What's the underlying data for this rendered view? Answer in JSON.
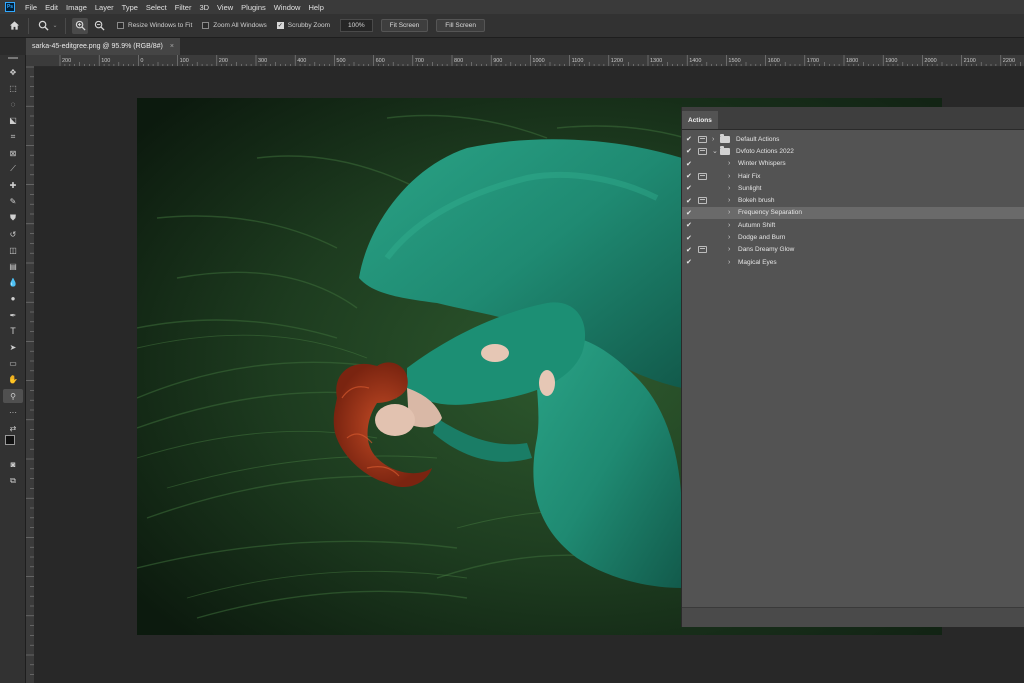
{
  "menubar": {
    "logo": "Ps",
    "items": [
      "File",
      "Edit",
      "Image",
      "Layer",
      "Type",
      "Select",
      "Filter",
      "3D",
      "View",
      "Plugins",
      "Window",
      "Help"
    ]
  },
  "options": {
    "icons": [
      "home-icon",
      "zoom-tool-icon",
      "zoom-in-icon",
      "zoom-out-icon"
    ],
    "resize_windows": {
      "label": "Resize Windows to Fit",
      "checked": false
    },
    "zoom_all": {
      "label": "Zoom All Windows",
      "checked": false
    },
    "scrubby_zoom": {
      "label": "Scrubby Zoom",
      "checked": true
    },
    "zoom_value": "100%",
    "fit_screen": "Fit Screen",
    "fill_screen": "Fill Screen"
  },
  "document": {
    "tab_title": "sarka-45-editgree.png @ 95.9% (RGB/8#)",
    "close_glyph": "×"
  },
  "ruler": {
    "labels": [
      "200",
      "100",
      "0",
      "100",
      "200",
      "300",
      "400",
      "500",
      "600",
      "700",
      "800",
      "900",
      "1000",
      "1100",
      "1200",
      "1300",
      "1400",
      "1500",
      "1600",
      "1700",
      "1800",
      "1900",
      "2000",
      "2100",
      "2200"
    ]
  },
  "toolbar": {
    "tools": [
      "move-tool-icon",
      "marquee-tool-icon",
      "lasso-tool-icon",
      "object-select-tool-icon",
      "crop-tool-icon",
      "frame-tool-icon",
      "eyedropper-tool-icon",
      "healing-brush-tool-icon",
      "brush-tool-icon",
      "clone-stamp-tool-icon",
      "history-brush-tool-icon",
      "eraser-tool-icon",
      "gradient-tool-icon",
      "blur-tool-icon",
      "dodge-tool-icon",
      "pen-tool-icon",
      "type-tool-icon",
      "path-select-tool-icon",
      "shape-tool-icon",
      "hand-tool-icon",
      "zoom-tool-icon",
      "more-tools-icon",
      "swap-colors-icon",
      "color-swatches-icon",
      "quick-mask-icon",
      "screen-mode-icon"
    ],
    "active_tool": "zoom-tool-icon"
  },
  "actions_panel": {
    "tab_label": "Actions",
    "rows": [
      {
        "label": "Default Actions",
        "checked": true,
        "dialog": true,
        "type": "set",
        "expanded": false
      },
      {
        "label": "Dvfoto Actions 2022",
        "checked": true,
        "dialog": true,
        "type": "set",
        "expanded": true
      },
      {
        "label": "Winter Whispers",
        "checked": true,
        "dialog": false,
        "type": "action"
      },
      {
        "label": "Hair Fix",
        "checked": true,
        "dialog": true,
        "type": "action"
      },
      {
        "label": "Sunlight",
        "checked": true,
        "dialog": false,
        "type": "action"
      },
      {
        "label": "Bokeh brush",
        "checked": true,
        "dialog": true,
        "type": "action"
      },
      {
        "label": "Frequency Separation",
        "checked": true,
        "dialog": false,
        "type": "action",
        "selected": true
      },
      {
        "label": "Autumn Shift",
        "checked": true,
        "dialog": false,
        "type": "action"
      },
      {
        "label": "Dodge and Burn",
        "checked": true,
        "dialog": false,
        "type": "action"
      },
      {
        "label": "Dans Dreamy Glow",
        "checked": true,
        "dialog": true,
        "type": "action"
      },
      {
        "label": "Magical Eyes",
        "checked": true,
        "dialog": false,
        "type": "action"
      }
    ]
  },
  "colors": {
    "accent": "#31a8ff",
    "dress": "#1f8a72",
    "hair": "#a8341a",
    "grass": "#1d3b1f"
  }
}
